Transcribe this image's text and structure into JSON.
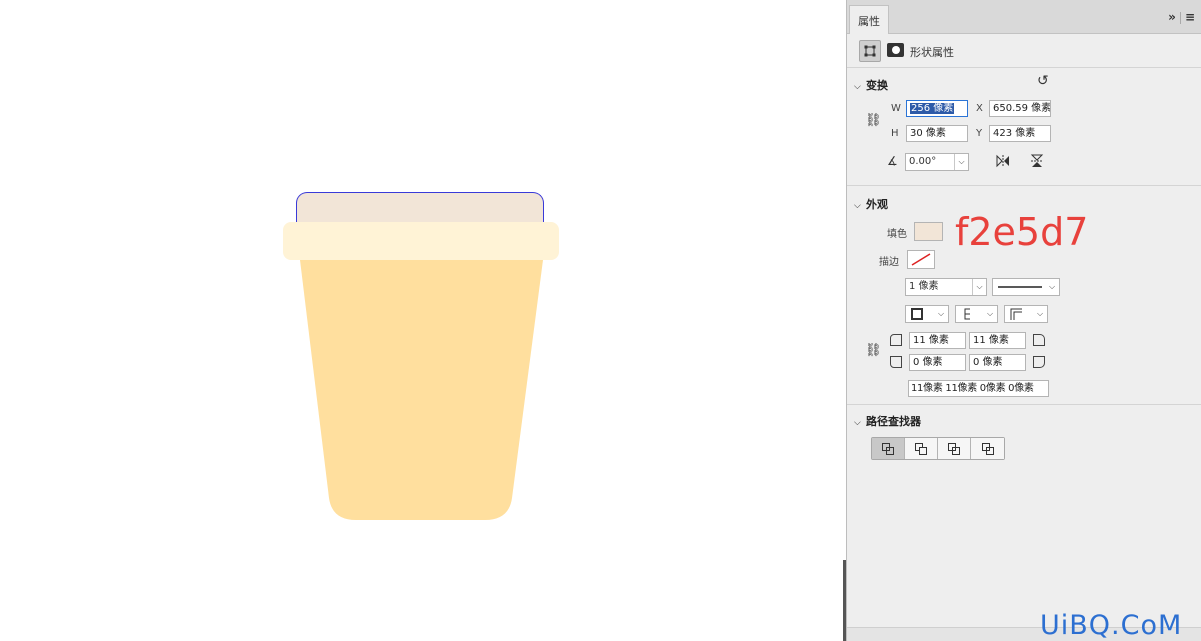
{
  "colors": {
    "lid_fill": "#f2e5d7",
    "rim_fill": "#fff3d6",
    "body_fill": "#ffdf9e",
    "selection_outline": "#3a3ad8",
    "annotation": "#e8413c",
    "watermark": "#2c6fd1"
  },
  "panel": {
    "tab_label": "属性",
    "collapse_icon": "double-chevron-right-icon",
    "menu_icon": "hamburger-menu-icon",
    "kind_label": "形状属性",
    "transform": {
      "title": "变换",
      "w_label": "W",
      "w_value": "256 像素",
      "x_label": "X",
      "x_value": "650.59 像素",
      "h_label": "H",
      "h_value": "30 像素",
      "y_label": "Y",
      "y_value": "423 像素",
      "angle_value": "0.00°"
    },
    "appearance": {
      "title": "外观",
      "fill_label": "填色",
      "fill_color": "#f2e5d7",
      "stroke_label": "描边",
      "stroke_width": "1 像素",
      "corner_tl": "11 像素",
      "corner_tr": "11 像素",
      "corner_bl": "0 像素",
      "corner_br": "0 像素",
      "corners_summary": "11像素 11像素 0像素 0像素"
    },
    "pathfinder": {
      "title": "路径查找器"
    }
  },
  "annotation_text": "f2e5d7",
  "watermark_text": "UiBQ.CoM"
}
